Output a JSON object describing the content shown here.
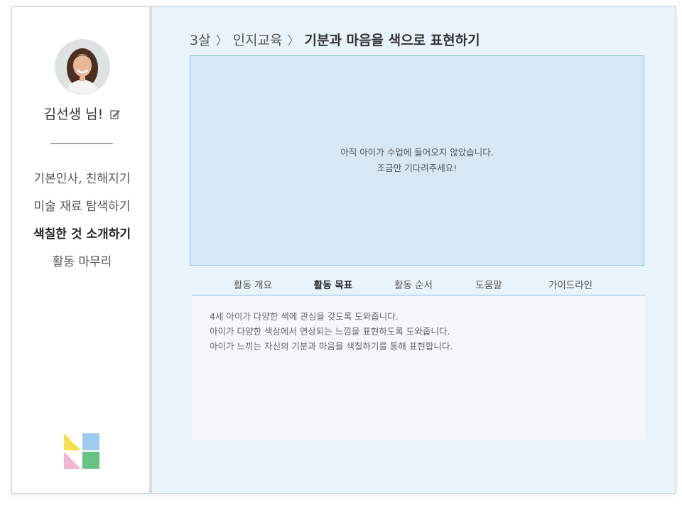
{
  "user": {
    "name": "김선생",
    "honorific": "님!"
  },
  "sidebar": {
    "items": [
      {
        "label": "기본인사, 친해지기",
        "active": false
      },
      {
        "label": "미술 재료 탐색하기",
        "active": false
      },
      {
        "label": "색칠한 것 소개하기",
        "active": true
      },
      {
        "label": "활동 마무리",
        "active": false
      }
    ]
  },
  "breadcrumb": {
    "age": "3살",
    "category": "인지교육",
    "current": "기분과 마음을 색으로 표현하기"
  },
  "video": {
    "message_line1": "아직 아이가 수업에 들어오지 않았습니다.",
    "message_line2": "조금만 기다려주세요!"
  },
  "tabs": [
    {
      "label": "활동 개요",
      "active": false
    },
    {
      "label": "활동 목표",
      "active": true
    },
    {
      "label": "활동 순서",
      "active": false
    },
    {
      "label": "도움말",
      "active": false
    },
    {
      "label": "가이드라인",
      "active": false
    }
  ],
  "panel": {
    "lines": [
      "4세 아이가 다양한 색에 관심을 갖도록 도와줍니다.",
      "아이가 다양한 색상에서 연상되는 느낌을 표현하도록 도와줍니다.",
      "아이가 느끼는 자신의 기분과 마음을 색칠하기를 통해 표현합니다."
    ]
  },
  "colors": {
    "background": "#e9f3fb",
    "video_bg": "#d6e8f6",
    "accent_border": "#8fc3e8",
    "logo_yellow": "#f5e04e",
    "logo_blue": "#9ecbee",
    "logo_pink": "#f0b6d6",
    "logo_green": "#67c182"
  },
  "icons": {
    "edit": "edit-icon",
    "logo": "app-logo"
  }
}
